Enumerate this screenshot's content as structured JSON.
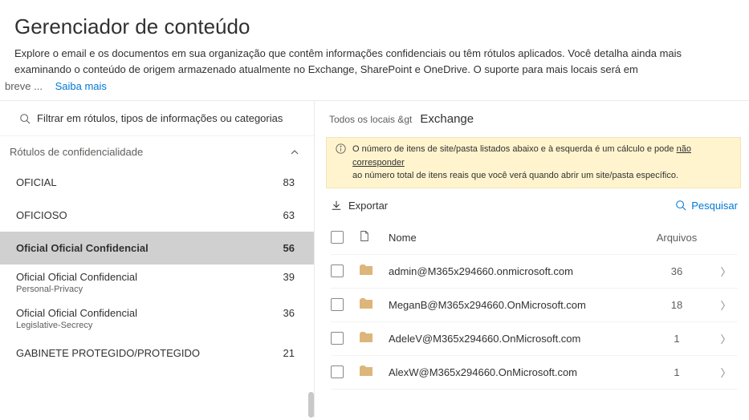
{
  "header": {
    "title": "Gerenciador de conteúdo",
    "description": "Explore o email e os documentos em sua organização que contêm informações confidenciais ou têm rótulos aplicados. Você detalha ainda mais examinando o conteúdo de origem armazenado atualmente no Exchange, SharePoint e OneDrive. O suporte para mais locais será em",
    "breve": "breve ...",
    "learn_more": "Saiba mais"
  },
  "left": {
    "filter_placeholder": "Filtrar em rótulos, tipos de informações ou categorias",
    "section_title": "Rótulos de confidencialidade",
    "items": [
      {
        "label": "OFICIAL",
        "count": "83",
        "selected": false,
        "sub": ""
      },
      {
        "label": "OFICIOSO",
        "count": "63",
        "selected": false,
        "sub": ""
      },
      {
        "label": "Oficial Oficial Confidencial",
        "count": "56",
        "selected": true,
        "sub": ""
      },
      {
        "label": "Oficial Oficial Confidencial",
        "count": "39",
        "selected": false,
        "sub": "Personal-Privacy"
      },
      {
        "label": "Oficial Oficial Confidencial",
        "count": "36",
        "selected": false,
        "sub": "Legislative-Secrecy"
      },
      {
        "label": "GABINETE PROTEGIDO/PROTEGIDO",
        "count": "21",
        "selected": false,
        "sub": ""
      }
    ]
  },
  "right": {
    "breadcrumb_all": "Todos os locais &gt",
    "breadcrumb_current": "Exchange",
    "banner_text1": "O número de itens de site/pasta listados abaixo e à esquerda é um cálculo e pode ",
    "banner_link": "não corresponder",
    "banner_text2": " ao número total de itens reais que você verá quando abrir um site/pasta específico.",
    "export_label": "Exportar",
    "search_label": "Pesquisar",
    "columns": {
      "name": "Nome",
      "files": "Arquivos"
    },
    "rows": [
      {
        "name": "admin@M365x294660.onmicrosoft.com",
        "count": "36"
      },
      {
        "name": "MeganB@M365x294660.OnMicrosoft.com",
        "count": "18"
      },
      {
        "name": "AdeleV@M365x294660.OnMicrosoft.com",
        "count": "1"
      },
      {
        "name": "AlexW@M365x294660.OnMicrosoft.com",
        "count": "1"
      }
    ]
  }
}
